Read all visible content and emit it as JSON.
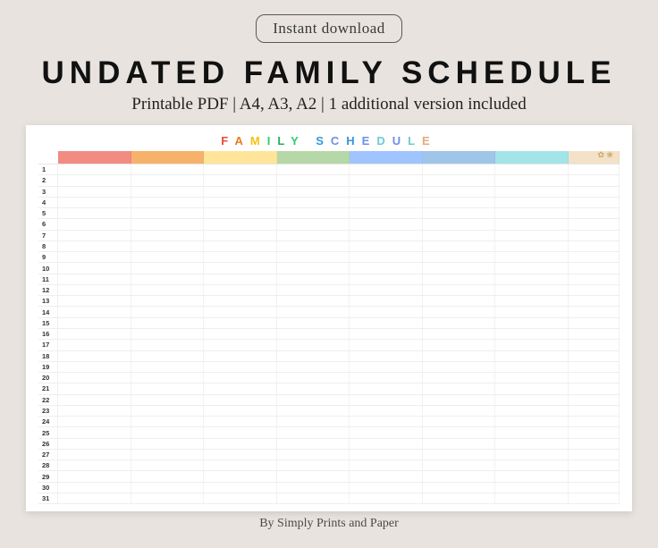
{
  "badge": "Instant download",
  "title": "UNDATED FAMILY SCHEDULE",
  "subtitle": "Printable PDF | A4, A3, A2 | 1 additional version included",
  "sheet_title_letters": [
    "F",
    "A",
    "M",
    "I",
    "L",
    "Y",
    " ",
    "S",
    "C",
    "H",
    "E",
    "D",
    "U",
    "L",
    "E"
  ],
  "sheet_title_colors": [
    "l0",
    "l1",
    "l2",
    "l3",
    "l4",
    "l3",
    " ",
    "l5",
    "l6",
    "l5",
    "l6",
    "l7",
    "l6",
    "l7",
    "l8"
  ],
  "column_colors": [
    "c0",
    "c1",
    "c2",
    "c3",
    "c4",
    "c5",
    "c6",
    "c7"
  ],
  "row_count": 31,
  "credit": "By Simply Prints and Paper"
}
